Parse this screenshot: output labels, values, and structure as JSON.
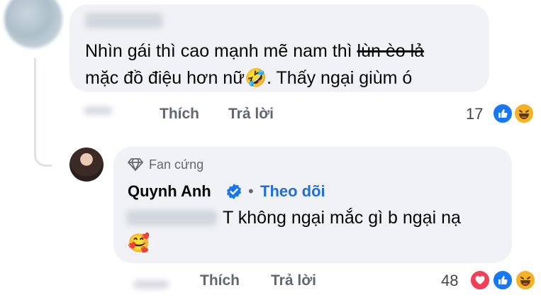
{
  "comment": {
    "line1_text": "Nhìn gái thì cao mạnh mẽ nam thì ",
    "line1_struck": "lùn èo lả",
    "line2_text": "mặc đồ điệu hơn nữ",
    "line2_emoji": "🤣",
    "line2_end": ". Thấy ngại giùm ó",
    "like_label": "Thích",
    "reply_label": "Trả lời",
    "reaction_count": "17",
    "reactions": [
      "like-icon",
      "haha-icon"
    ]
  },
  "reply": {
    "badge_label": "Fan cứng",
    "author_name": "Quynh Anh",
    "follow_label": "Theo dõi",
    "separator": "•",
    "text": "T không ngại mắc gì b ngại nạ",
    "emoji": "🥰",
    "like_label": "Thích",
    "reply_label": "Trả lời",
    "reaction_count": "48",
    "reactions": [
      "love-icon",
      "like-icon",
      "haha-icon"
    ]
  },
  "colors": {
    "bubble_bg": "#f0f2f5",
    "link_blue": "#216fdb",
    "verified_blue": "#1877f2",
    "action_gray": "#606770"
  }
}
